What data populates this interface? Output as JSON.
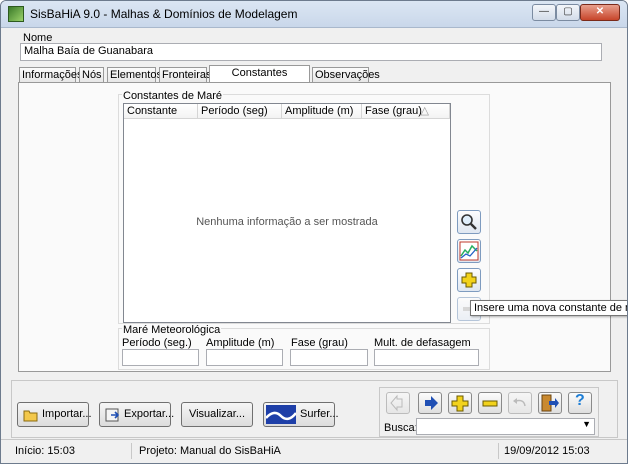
{
  "window": {
    "title": "SisBaHiA 9.0 - Malhas & Domínios de Modelagem"
  },
  "nome": {
    "label": "Nome",
    "value": "Malha Baía de Guanabara"
  },
  "tabs": [
    {
      "label": "Informações"
    },
    {
      "label": "Nós"
    },
    {
      "label": "Elementos"
    },
    {
      "label": "Fronteiras"
    },
    {
      "label": "Constantes Harmônicas"
    },
    {
      "label": "Observações"
    }
  ],
  "constantes": {
    "group_label": "Constantes de Maré",
    "columns": [
      "Constante",
      "Período (seg)",
      "Amplitude (m)",
      "Fase (grau)"
    ],
    "sort_indicator": "△",
    "empty_message": "Nenhuma informação a ser mostrada"
  },
  "side_buttons": {
    "view_icon": "magnifier-icon",
    "chart_icon": "chart-icon",
    "add_icon": "plus-icon",
    "remove_icon": "minus-icon"
  },
  "tooltip": "Insere uma nova constante de maré",
  "meteorologica": {
    "group_label": "Maré Meteorológica",
    "fields": [
      {
        "label": "Período (seg.)",
        "value": ""
      },
      {
        "label": "Amplitude (m)",
        "value": ""
      },
      {
        "label": "Fase (grau)",
        "value": ""
      },
      {
        "label": "Mult. de defasagem",
        "value": ""
      }
    ]
  },
  "buttons": {
    "importar": "Importar...",
    "exportar": "Exportar...",
    "visualizar": "Visualizar...",
    "surfer": "Surfer..."
  },
  "nav": {
    "busca_label": "Busca:",
    "busca_value": ""
  },
  "status": {
    "inicio": "Início: 15:03",
    "projeto": "Projeto: Manual do SisBaHiA",
    "datetime": "19/09/2012 15:03"
  },
  "colors": {
    "accent_blue": "#1f4fb4",
    "plus_yellow": "#f2d21b",
    "help_blue": "#1f7fd6"
  }
}
